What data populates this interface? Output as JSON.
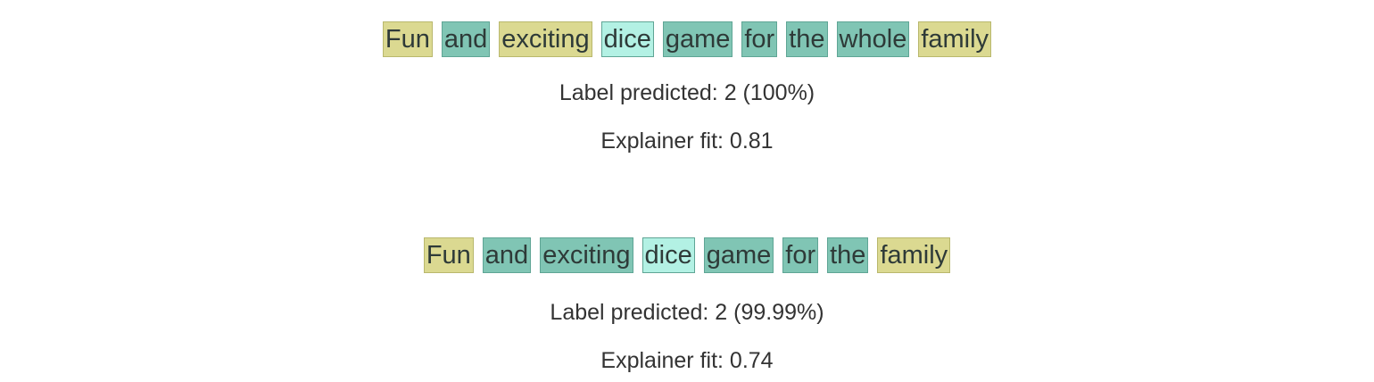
{
  "colors": {
    "positive": "#dbd991",
    "positive_border": "#b9b86d",
    "negative": "#80c5b4",
    "negative_border": "#5fa595",
    "weak": "#b3f1e4",
    "weak_border": "#5fa595"
  },
  "explanations": [
    {
      "tokens": [
        {
          "text": "Fun",
          "weight": "positive"
        },
        {
          "text": "and",
          "weight": "negative"
        },
        {
          "text": "exciting",
          "weight": "positive"
        },
        {
          "text": "dice",
          "weight": "weak"
        },
        {
          "text": "game",
          "weight": "negative"
        },
        {
          "text": "for",
          "weight": "negative"
        },
        {
          "text": "the",
          "weight": "negative"
        },
        {
          "text": "whole",
          "weight": "negative"
        },
        {
          "text": "family",
          "weight": "positive"
        }
      ],
      "label_text": "Label predicted: 2 (100%)",
      "fit_text": "Explainer fit: 0.81"
    },
    {
      "tokens": [
        {
          "text": "Fun",
          "weight": "positive"
        },
        {
          "text": "and",
          "weight": "negative"
        },
        {
          "text": "exciting",
          "weight": "negative"
        },
        {
          "text": "dice",
          "weight": "weak"
        },
        {
          "text": "game",
          "weight": "negative"
        },
        {
          "text": "for",
          "weight": "negative"
        },
        {
          "text": "the",
          "weight": "negative"
        },
        {
          "text": "family",
          "weight": "positive"
        }
      ],
      "label_text": "Label predicted: 2 (99.99%)",
      "fit_text": "Explainer fit: 0.74"
    }
  ]
}
